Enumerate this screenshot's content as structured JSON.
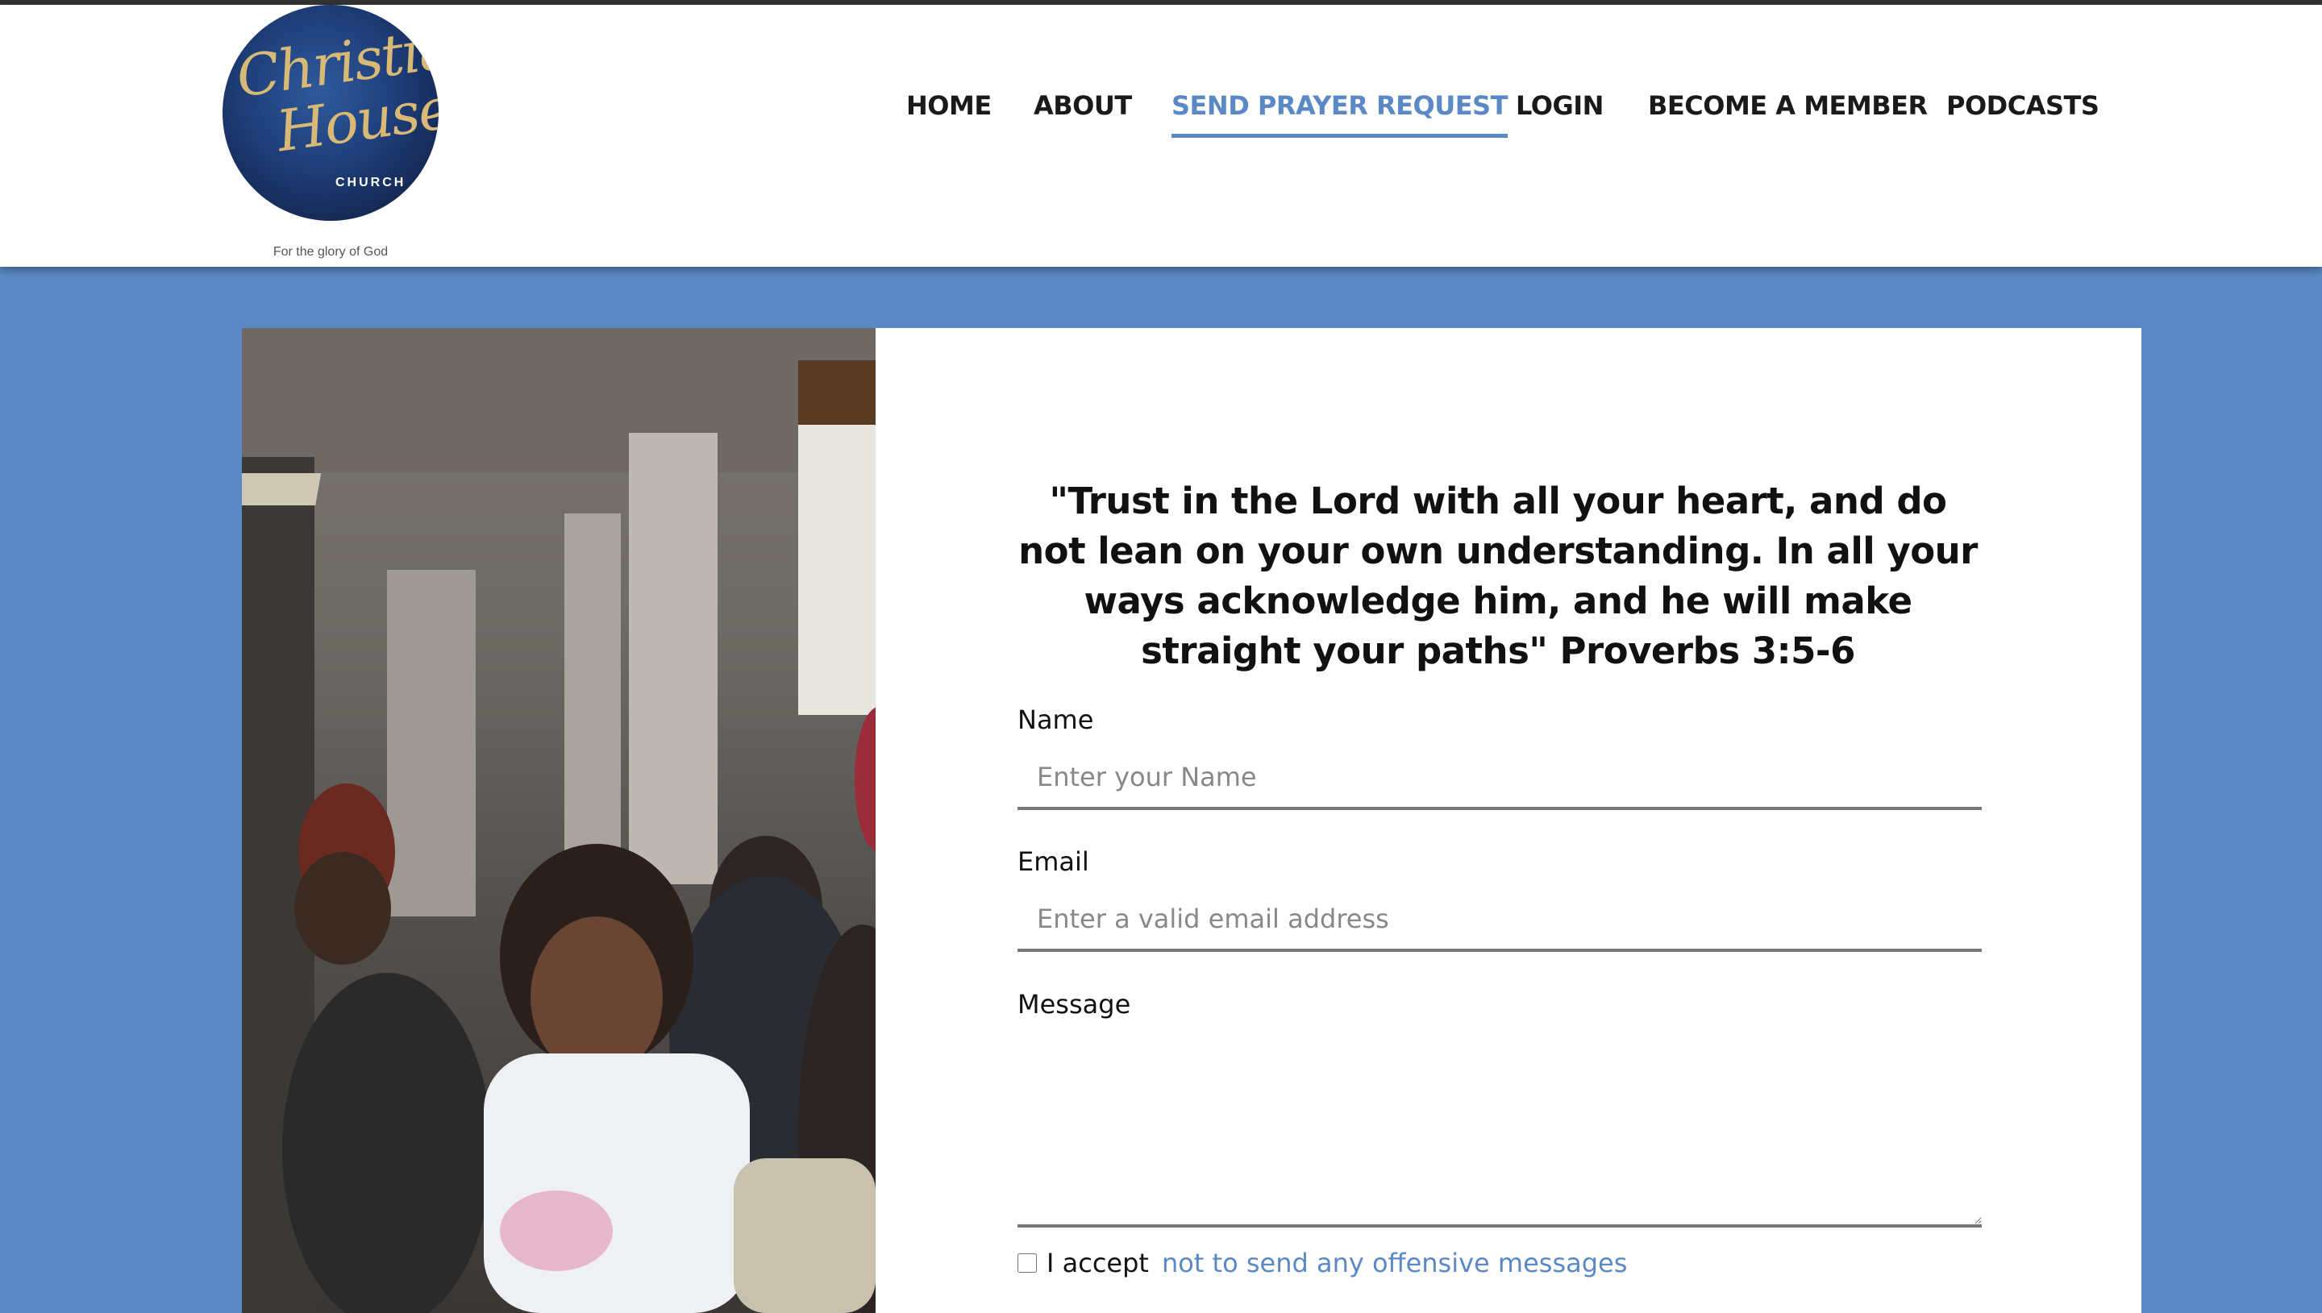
{
  "header": {
    "logo": {
      "line1": "Christian",
      "line2": "House",
      "sub": "CHURCH"
    },
    "tagline": "For the glory of God"
  },
  "nav": {
    "items": [
      {
        "label": "HOME"
      },
      {
        "label": "ABOUT"
      },
      {
        "label": "SEND PRAYER REQUEST",
        "active": true
      },
      {
        "label": "LOGIN"
      },
      {
        "label": "BECOME A MEMBER"
      },
      {
        "label": "PODCASTS"
      }
    ]
  },
  "form": {
    "verse": "\"Trust in the Lord with all your heart, and do not lean on your own understanding. In all your ways acknowledge him, and he will make straight your paths\" Proverbs 3:5-6",
    "name_label": "Name",
    "name_placeholder": "Enter your Name",
    "email_label": "Email",
    "email_placeholder": "Enter a valid email address",
    "message_label": "Message",
    "accept_text": "I accept",
    "accept_link": "not to send any offensive messages"
  },
  "colors": {
    "accent": "#5a89c6",
    "header_bg": "#ffffff",
    "logo_gold": "#d8b975",
    "logo_navy": "#1e3d78"
  }
}
